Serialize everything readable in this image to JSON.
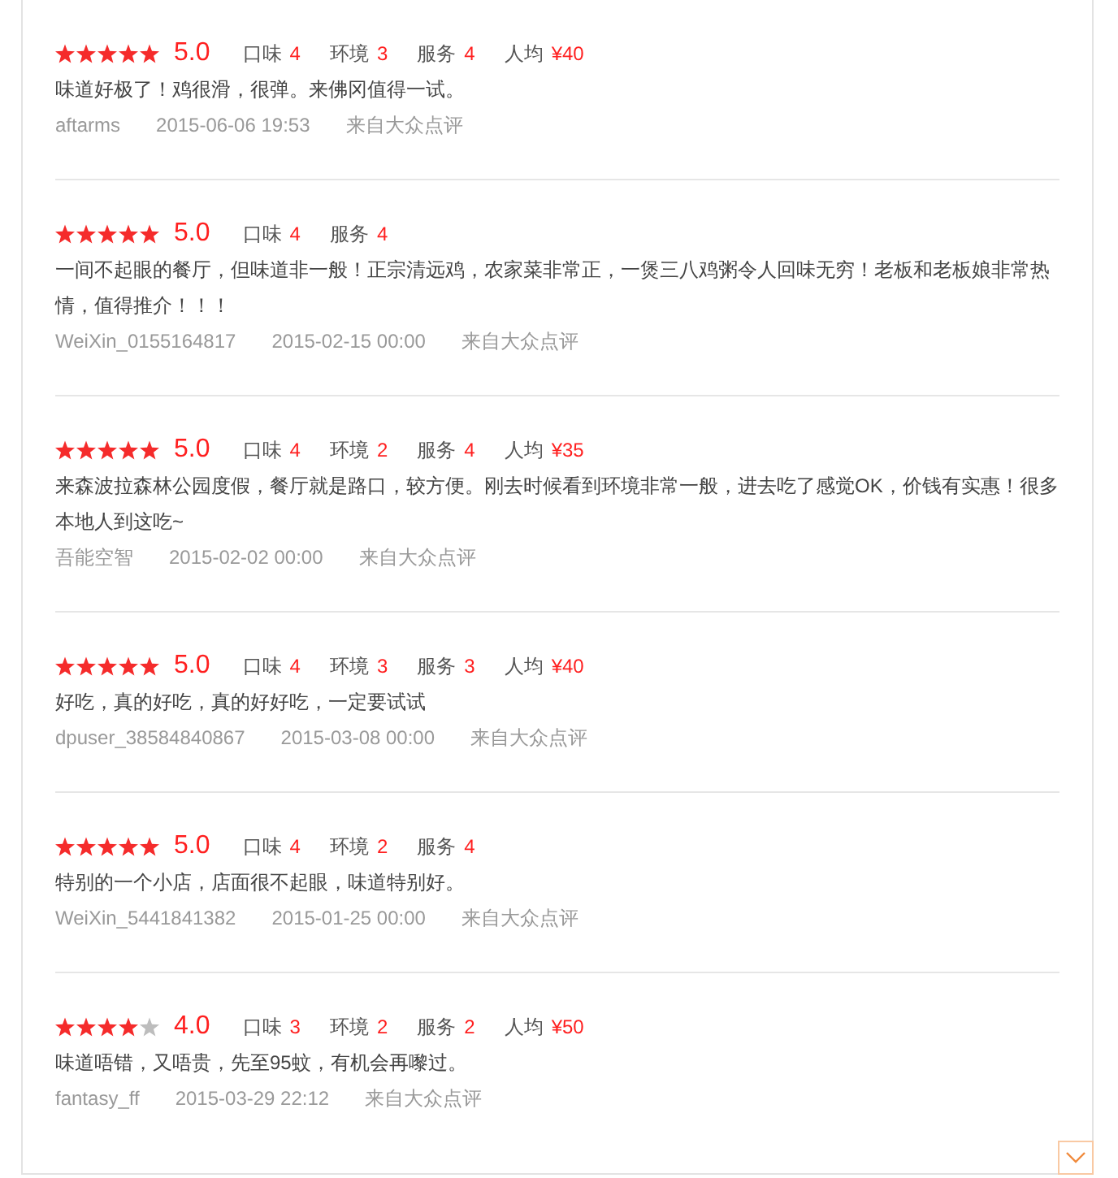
{
  "reviews": [
    {
      "stars": 5,
      "score": "5.0",
      "ratings": [
        {
          "label": "口味",
          "value": "4"
        },
        {
          "label": "环境",
          "value": "3"
        },
        {
          "label": "服务",
          "value": "4"
        },
        {
          "label": "人均",
          "value": "¥40"
        }
      ],
      "text": "味道好极了！鸡很滑，很弹。来佛冈值得一试。",
      "user": "aftarms",
      "time": "2015-06-06 19:53",
      "source": "来自大众点评"
    },
    {
      "stars": 5,
      "score": "5.0",
      "ratings": [
        {
          "label": "口味",
          "value": "4"
        },
        {
          "label": "服务",
          "value": "4"
        }
      ],
      "text": "一间不起眼的餐厅，但味道非一般！正宗清远鸡，农家菜非常正，一煲三八鸡粥令人回味无穷！老板和老板娘非常热情，值得推介！！！",
      "user": "WeiXin_0155164817",
      "time": "2015-02-15 00:00",
      "source": "来自大众点评"
    },
    {
      "stars": 5,
      "score": "5.0",
      "ratings": [
        {
          "label": "口味",
          "value": "4"
        },
        {
          "label": "环境",
          "value": "2"
        },
        {
          "label": "服务",
          "value": "4"
        },
        {
          "label": "人均",
          "value": "¥35"
        }
      ],
      "text": "来森波拉森林公园度假，餐厅就是路口，较方便。刚去时候看到环境非常一般，进去吃了感觉OK，价钱有实惠！很多本地人到这吃~",
      "user": "吾能空智",
      "time": "2015-02-02 00:00",
      "source": "来自大众点评"
    },
    {
      "stars": 5,
      "score": "5.0",
      "ratings": [
        {
          "label": "口味",
          "value": "4"
        },
        {
          "label": "环境",
          "value": "3"
        },
        {
          "label": "服务",
          "value": "3"
        },
        {
          "label": "人均",
          "value": "¥40"
        }
      ],
      "text": "好吃，真的好吃，真的好好吃，一定要试试",
      "user": "dpuser_38584840867",
      "time": "2015-03-08 00:00",
      "source": "来自大众点评"
    },
    {
      "stars": 5,
      "score": "5.0",
      "ratings": [
        {
          "label": "口味",
          "value": "4"
        },
        {
          "label": "环境",
          "value": "2"
        },
        {
          "label": "服务",
          "value": "4"
        }
      ],
      "text": "特别的一个小店，店面很不起眼，味道特别好。",
      "user": "WeiXin_5441841382",
      "time": "2015-01-25 00:00",
      "source": "来自大众点评"
    },
    {
      "stars": 4,
      "score": "4.0",
      "ratings": [
        {
          "label": "口味",
          "value": "3"
        },
        {
          "label": "环境",
          "value": "2"
        },
        {
          "label": "服务",
          "value": "2"
        },
        {
          "label": "人均",
          "value": "¥50"
        }
      ],
      "text": "味道唔错，又唔贵，先至95蚊，有机会再嚟过。",
      "user": "fantasy_ff",
      "time": "2015-03-29 22:12",
      "source": "来自大众点评"
    }
  ]
}
